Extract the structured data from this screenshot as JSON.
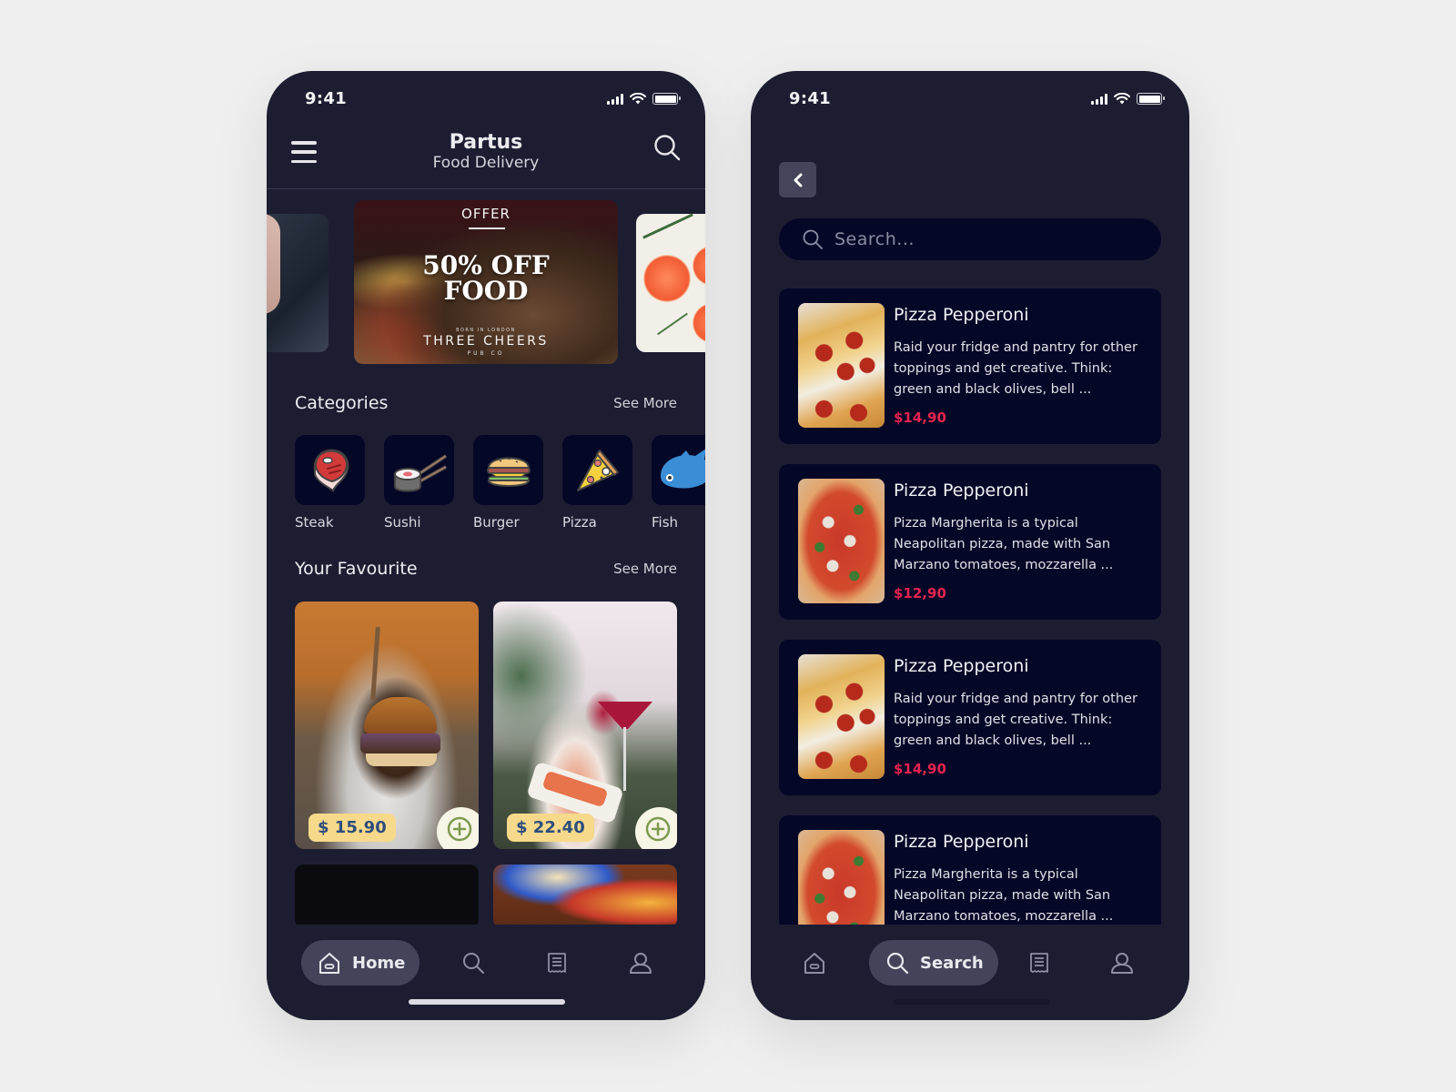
{
  "colors": {
    "background": "#efefef",
    "phone_bg": "#1d1d32",
    "card_bg": "#050726",
    "active_nav_bg": "#43435a",
    "price_accent": "#e5234f",
    "price_badge_bg": "#f6d98b",
    "price_badge_text": "#2d4d7c",
    "add_button_bg": "#f7f5e6",
    "add_button_icon": "#7d9a4f"
  },
  "home": {
    "status_bar": {
      "time": "9:41",
      "icons": [
        "signal-icon",
        "wifi-icon",
        "battery-icon"
      ]
    },
    "header": {
      "title": "Partus",
      "subtitle": "Food Delivery",
      "left_icon": "menu-icon",
      "right_icon": "search-icon"
    },
    "banner": {
      "tag": "OFFER",
      "headline_line1": "50% OFF",
      "headline_line2": "FOOD",
      "brand_small": "BORN IN LONDON",
      "brand": "THREE CHEERS",
      "brand_sub": "PUB CO"
    },
    "categories": {
      "title": "Categories",
      "see_more": "See More",
      "items": [
        {
          "label": "Steak",
          "icon": "steak-icon"
        },
        {
          "label": "Sushi",
          "icon": "sushi-icon"
        },
        {
          "label": "Burger",
          "icon": "burger-icon"
        },
        {
          "label": "Pizza",
          "icon": "pizza-icon"
        },
        {
          "label": "Fish",
          "icon": "fish-icon"
        }
      ]
    },
    "favourite": {
      "title": "Your Favourite",
      "see_more": "See More",
      "items": [
        {
          "price": "$ 15.90",
          "image": "burger-photo"
        },
        {
          "price": "$ 22.40",
          "image": "sushi-cocktail-photo"
        },
        {
          "image": "dark-photo"
        },
        {
          "image": "pancake-photo"
        }
      ]
    },
    "nav": {
      "items": [
        {
          "label": "Home",
          "icon": "home-icon",
          "active": true
        },
        {
          "label": "Search",
          "icon": "search-icon",
          "active": false
        },
        {
          "label": "Orders",
          "icon": "receipt-icon",
          "active": false
        },
        {
          "label": "Profile",
          "icon": "user-icon",
          "active": false
        }
      ]
    }
  },
  "search": {
    "status_bar": {
      "time": "9:41",
      "icons": [
        "signal-icon",
        "wifi-icon",
        "battery-icon"
      ]
    },
    "back_icon": "chevron-left-icon",
    "search_placeholder": "Search...",
    "search_value": "",
    "results": [
      {
        "title": "Pizza Pepperoni",
        "description": "Raid your fridge and pantry for other toppings and get creative. Think: green and black olives, bell ...",
        "price": "$14,90",
        "image": "pepperoni-photo"
      },
      {
        "title": "Pizza Pepperoni",
        "description": "Pizza Margherita is a typical Neapolitan pizza, made with San Marzano tomatoes, mozzarella ...",
        "price": "$12,90",
        "image": "margherita-photo"
      },
      {
        "title": "Pizza Pepperoni",
        "description": "Raid your fridge and pantry for other toppings and get creative. Think: green and black olives, bell ...",
        "price": "$14,90",
        "image": "pepperoni-photo"
      },
      {
        "title": "Pizza Pepperoni",
        "description": "Pizza Margherita is a typical Neapolitan pizza, made with San Marzano tomatoes, mozzarella ...",
        "price": "",
        "image": "margherita-photo"
      }
    ],
    "nav": {
      "items": [
        {
          "label": "Home",
          "icon": "home-icon",
          "active": false
        },
        {
          "label": "Search",
          "icon": "search-icon",
          "active": true
        },
        {
          "label": "Orders",
          "icon": "receipt-icon",
          "active": false
        },
        {
          "label": "Profile",
          "icon": "user-icon",
          "active": false
        }
      ]
    }
  }
}
